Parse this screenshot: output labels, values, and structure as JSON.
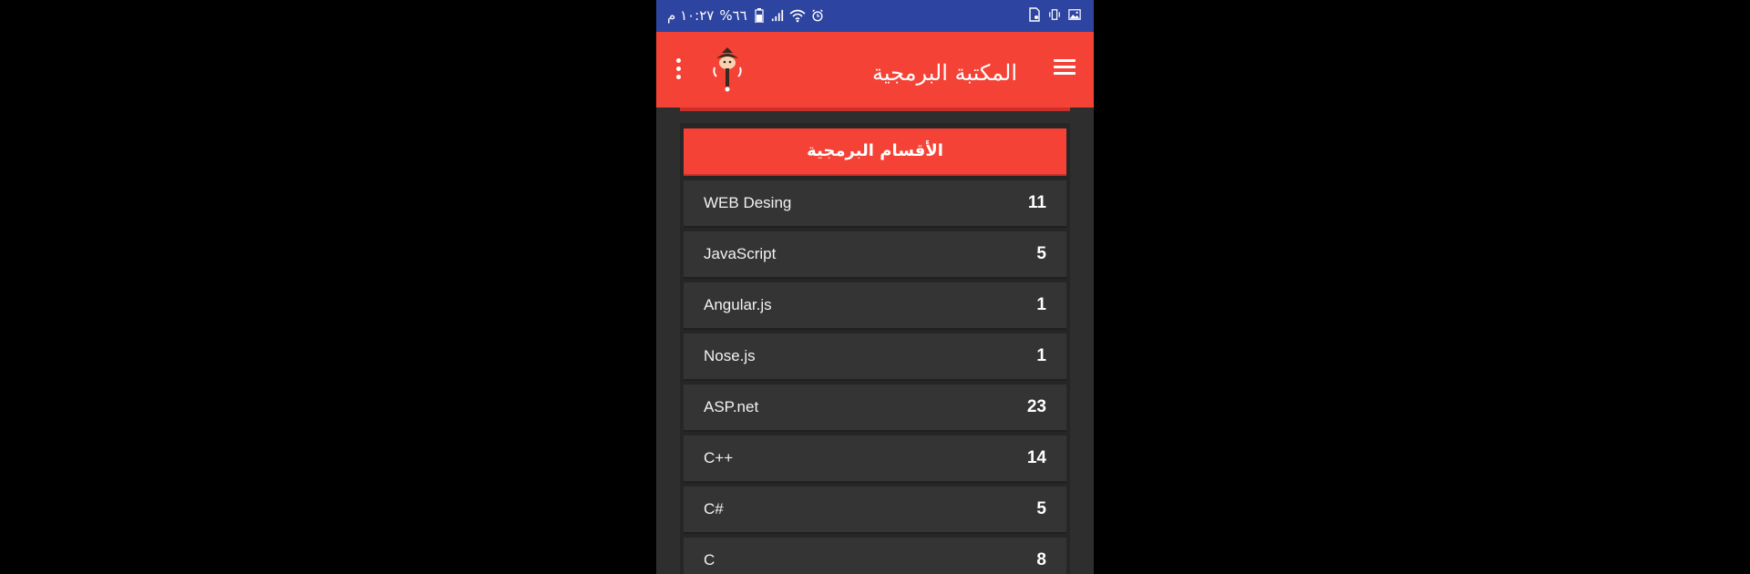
{
  "status_bar": {
    "time": "١٠:٢٧ م",
    "battery": "%٦٦",
    "icons": [
      "alarm-icon",
      "wifi-icon",
      "signal-icon",
      "battery-icon",
      "gallery-icon",
      "vibrate-icon",
      "sim-icon"
    ]
  },
  "app_bar": {
    "title": "المكتبة البرمجية",
    "menu_icon": "hamburger-menu-icon",
    "overflow_icon": "more-vert-icon",
    "logo": "app-logo"
  },
  "colors": {
    "status_bar": "#2d44a0",
    "primary": "#f44336",
    "background": "#2e2e2e",
    "row": "#343434"
  },
  "categories": {
    "header": "الأقسام البرمجية",
    "items": [
      {
        "name": "WEB Desing",
        "count": "11"
      },
      {
        "name": "JavaScript",
        "count": "5"
      },
      {
        "name": "Angular.js",
        "count": "1"
      },
      {
        "name": "Nose.js",
        "count": "1"
      },
      {
        "name": "ASP.net",
        "count": "23"
      },
      {
        "name": "C++",
        "count": "14"
      },
      {
        "name": "C#",
        "count": "5"
      },
      {
        "name": "C",
        "count": "8"
      }
    ]
  }
}
